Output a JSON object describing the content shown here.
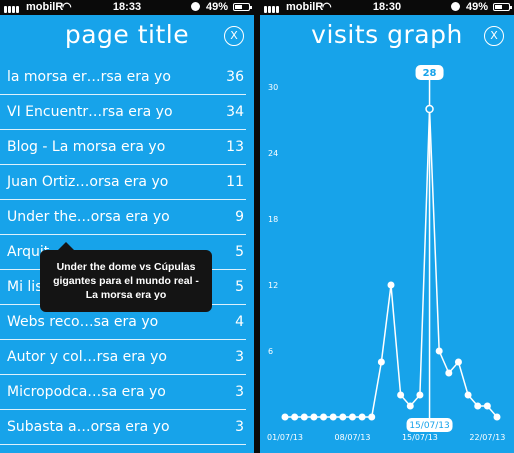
{
  "left_screen": {
    "status": {
      "carrier": "mobilR",
      "time": "18:33",
      "battery": "49%"
    },
    "title": "page title",
    "close_label": "X",
    "items": [
      {
        "name": "la morsa er…rsa era yo",
        "count": "36"
      },
      {
        "name": "VI Encuentr…rsa era yo",
        "count": "34"
      },
      {
        "name": "Blog - La morsa era yo",
        "count": "13"
      },
      {
        "name": "Juan Ortiz…orsa era yo",
        "count": "11"
      },
      {
        "name": "Under the…orsa era yo",
        "count": "9"
      },
      {
        "name": "Arquit…",
        "count": "5"
      },
      {
        "name": "Mi lis…",
        "count": "5"
      },
      {
        "name": "Webs reco…sa era yo",
        "count": "4"
      },
      {
        "name": "Autor y col…rsa era yo",
        "count": "3"
      },
      {
        "name": "Micropodca…sa era yo",
        "count": "3"
      },
      {
        "name": "Subasta a…orsa era yo",
        "count": "3"
      }
    ],
    "tooltip": {
      "lines": [
        "Under the dome vs Cúpulas",
        "gigantes para el mundo real -",
        "La morsa era yo"
      ]
    }
  },
  "right_screen": {
    "status": {
      "carrier": "mobilR",
      "time": "18:30",
      "battery": "49%"
    },
    "title": "visits graph",
    "close_label": "X",
    "selected_value": "28",
    "selected_date": "15/07/13"
  },
  "chart_data": {
    "type": "line",
    "ylim": [
      0,
      30
    ],
    "yticks": [
      "30",
      "24",
      "18",
      "12",
      "6"
    ],
    "xticks": [
      "01/07/13",
      "08/07/13",
      "15/07/13",
      "22/07/13"
    ],
    "color": "#ffffff",
    "values": [
      0,
      0,
      0,
      0,
      0,
      0,
      0,
      0,
      0,
      0,
      5,
      12,
      2,
      1,
      2,
      28,
      6,
      4,
      5,
      2,
      1,
      1,
      0
    ]
  }
}
